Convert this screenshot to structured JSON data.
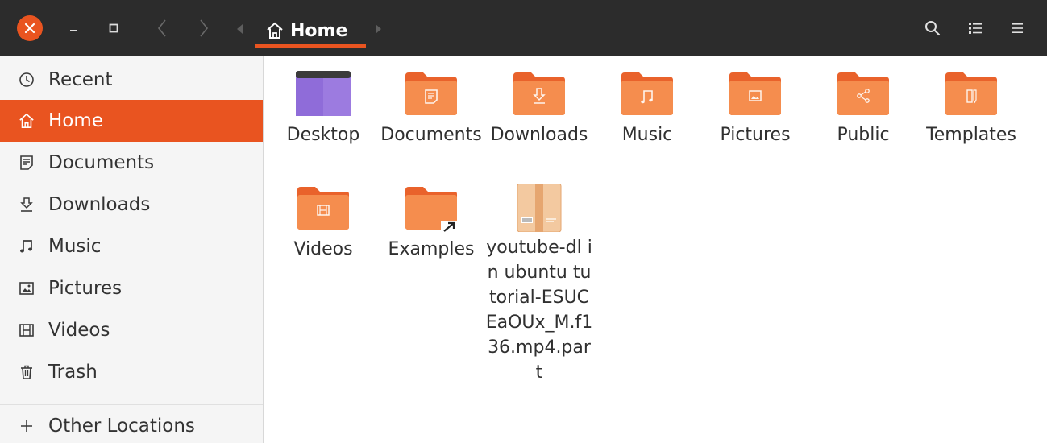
{
  "window": {
    "close_icon": "close-icon",
    "minimize_icon": "minimize-icon",
    "maximize_icon": "maximize-icon",
    "accent": "#e95420",
    "header_bg": "#2c2c2c"
  },
  "path_bar": {
    "current": "Home",
    "icon": "home-icon"
  },
  "toolbar": {
    "search_icon": "search-icon",
    "view_icon": "list-view-icon",
    "menu_icon": "hamburger-menu-icon"
  },
  "sidebar": {
    "items": [
      {
        "label": "Recent",
        "icon": "clock-icon",
        "active": false
      },
      {
        "label": "Home",
        "icon": "home-icon",
        "active": true
      },
      {
        "label": "Documents",
        "icon": "document-icon",
        "active": false
      },
      {
        "label": "Downloads",
        "icon": "download-icon",
        "active": false
      },
      {
        "label": "Music",
        "icon": "music-note-icon",
        "active": false
      },
      {
        "label": "Pictures",
        "icon": "picture-icon",
        "active": false
      },
      {
        "label": "Videos",
        "icon": "film-icon",
        "active": false
      },
      {
        "label": "Trash",
        "icon": "trash-icon",
        "active": false
      }
    ],
    "other_locations": {
      "label": "Other Locations",
      "icon": "plus-icon"
    }
  },
  "files": [
    {
      "name": "Desktop",
      "icon": "desktop-folder-icon"
    },
    {
      "name": "Documents",
      "icon": "documents-folder-icon"
    },
    {
      "name": "Downloads",
      "icon": "downloads-folder-icon"
    },
    {
      "name": "Music",
      "icon": "music-folder-icon"
    },
    {
      "name": "Pictures",
      "icon": "pictures-folder-icon"
    },
    {
      "name": "Public",
      "icon": "public-folder-icon"
    },
    {
      "name": "Templates",
      "icon": "templates-folder-icon"
    },
    {
      "name": "Videos",
      "icon": "videos-folder-icon"
    },
    {
      "name": "Examples",
      "icon": "examples-link-folder-icon"
    },
    {
      "name": "youtube-dl in ubuntu tutorial-ESUCEaOUx_M.f136.mp4.part",
      "icon": "package-file-icon"
    }
  ]
}
